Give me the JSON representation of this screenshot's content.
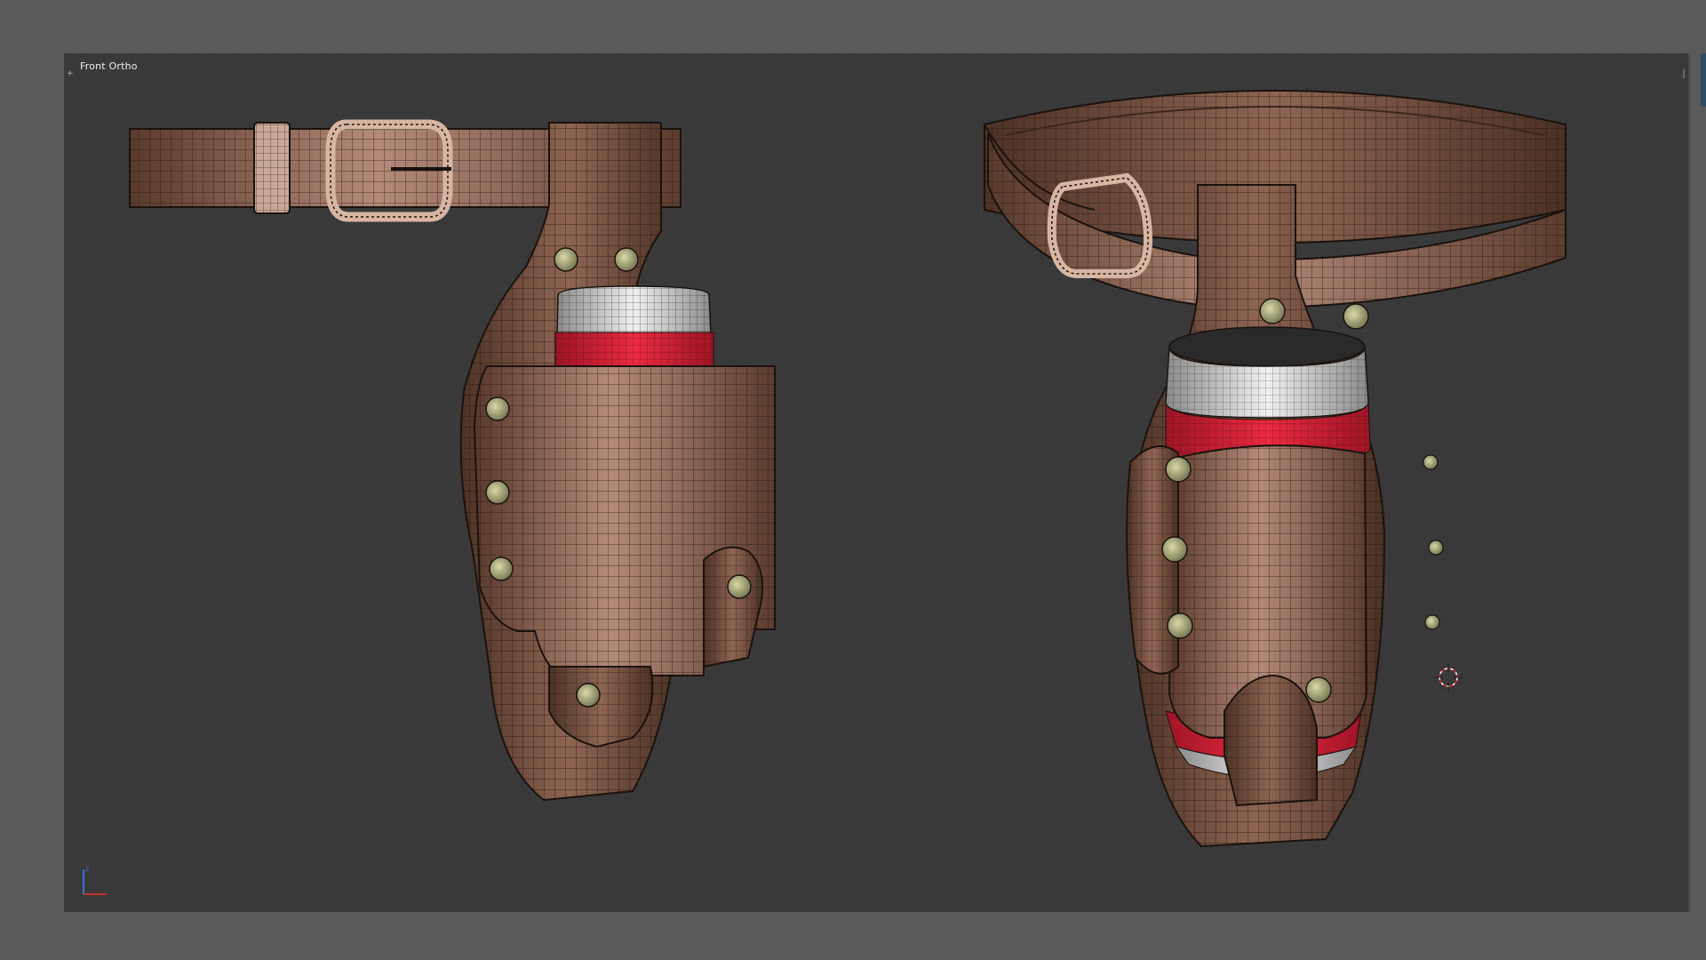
{
  "viewport": {
    "label": "Front Ortho",
    "background": "#393939",
    "grid_color": "#434343",
    "axis_label": "z"
  },
  "scene": {
    "objects": [
      {
        "name": "belt",
        "color": "#7a5545"
      },
      {
        "name": "holster",
        "color": "#6b4a3a"
      },
      {
        "name": "can",
        "band_color": "#d61f34",
        "top_color": "#d9d9d9"
      },
      {
        "name": "rivets",
        "color": "#b8b88a"
      }
    ],
    "views": [
      "front",
      "perspective"
    ]
  },
  "icons": {
    "3d-cursor": "crosshair-circle",
    "axis-gizmo": "xyz-axes"
  }
}
